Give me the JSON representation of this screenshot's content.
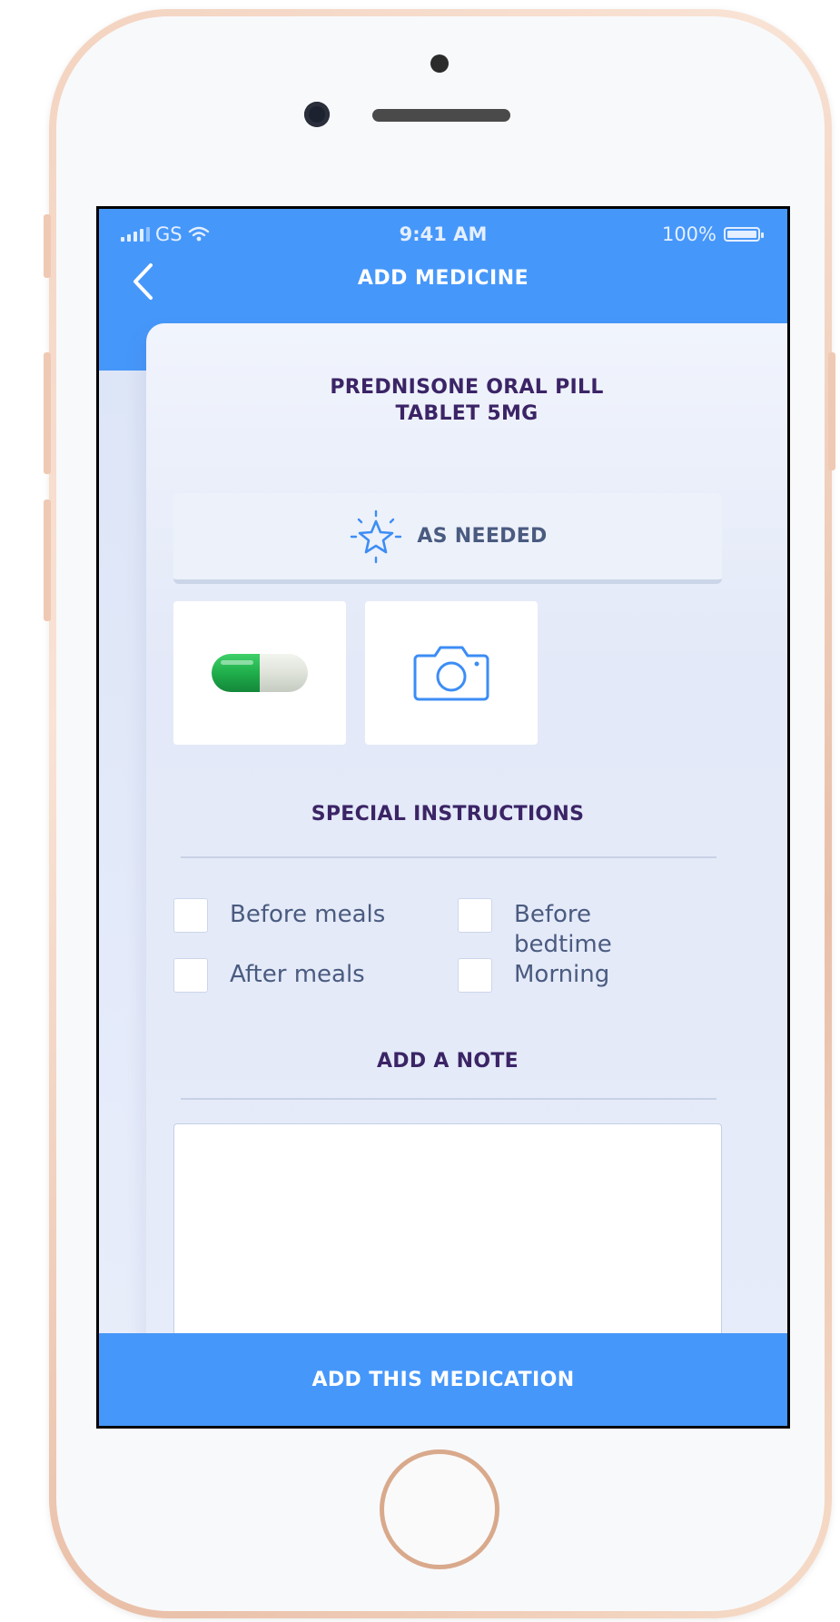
{
  "status_bar": {
    "carrier": "GS",
    "time": "9:41 AM",
    "battery": "100%"
  },
  "header": {
    "title": "ADD MEDICINE",
    "back_icon": "chevron-left-icon"
  },
  "medicine": {
    "name_line1": "PREDNISONE ORAL PILL",
    "name_line2": "TABLET 5MG"
  },
  "frequency": {
    "label": "AS NEEDED",
    "icon": "star-icon"
  },
  "photos": {
    "pill_icon": "capsule-icon",
    "camera_icon": "camera-icon"
  },
  "special_instructions": {
    "title": "SPECIAL INSTRUCTIONS",
    "options": [
      {
        "label": "Before meals",
        "checked": false
      },
      {
        "label": "Before bedtime",
        "checked": false
      },
      {
        "label": "After meals",
        "checked": false
      },
      {
        "label": "Morning",
        "checked": false
      }
    ]
  },
  "note": {
    "title": "ADD A NOTE",
    "value": ""
  },
  "submit": {
    "label": "ADD THIS MEDICATION"
  },
  "colors": {
    "primary": "#4697fa",
    "heading": "#3b2466",
    "text": "#4a5b80",
    "pill_green": "#1fae4a"
  }
}
